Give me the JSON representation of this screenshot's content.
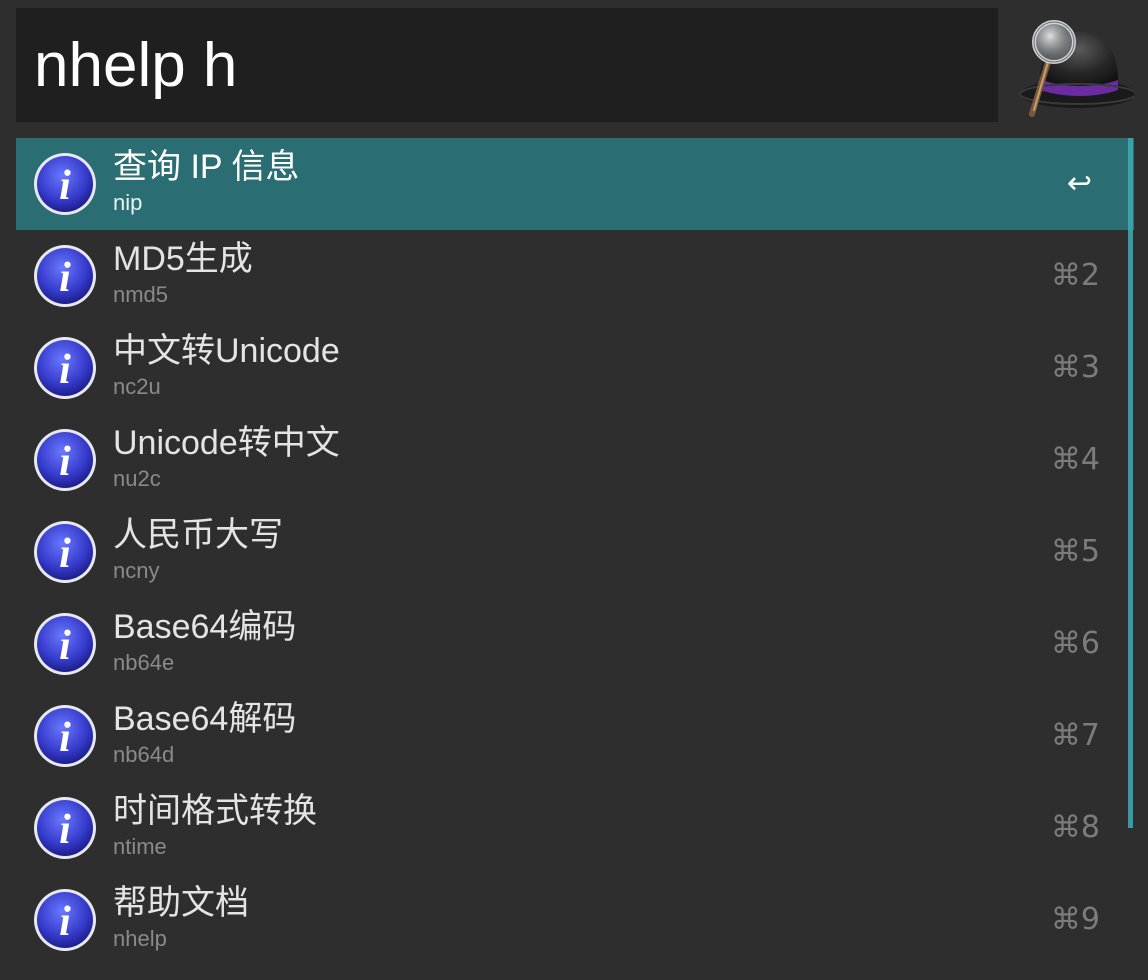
{
  "search": {
    "query": "nhelp h"
  },
  "logo": {
    "icon": "alfred-hat-magnifier-icon"
  },
  "colors": {
    "selected_row": "#2a6e74",
    "background": "#2e2e2e",
    "search_background": "#1f1f1f",
    "info_icon_blue": "#3a3fd0"
  },
  "results": [
    {
      "title": "查询 IP 信息",
      "subtitle": "nip",
      "shortcut": "↩",
      "icon": "info-icon",
      "selected": true
    },
    {
      "title": "MD5生成",
      "subtitle": "nmd5",
      "shortcut": "⌘2",
      "icon": "info-icon",
      "selected": false
    },
    {
      "title": "中文转Unicode",
      "subtitle": "nc2u",
      "shortcut": "⌘3",
      "icon": "info-icon",
      "selected": false
    },
    {
      "title": "Unicode转中文",
      "subtitle": "nu2c",
      "shortcut": "⌘4",
      "icon": "info-icon",
      "selected": false
    },
    {
      "title": "人民币大写",
      "subtitle": "ncny",
      "shortcut": "⌘5",
      "icon": "info-icon",
      "selected": false
    },
    {
      "title": "Base64编码",
      "subtitle": "nb64e",
      "shortcut": "⌘6",
      "icon": "info-icon",
      "selected": false
    },
    {
      "title": "Base64解码",
      "subtitle": "nb64d",
      "shortcut": "⌘7",
      "icon": "info-icon",
      "selected": false
    },
    {
      "title": "时间格式转换",
      "subtitle": "ntime",
      "shortcut": "⌘8",
      "icon": "info-icon",
      "selected": false
    },
    {
      "title": "帮助文档",
      "subtitle": "nhelp",
      "shortcut": "⌘9",
      "icon": "info-icon",
      "selected": false
    }
  ]
}
